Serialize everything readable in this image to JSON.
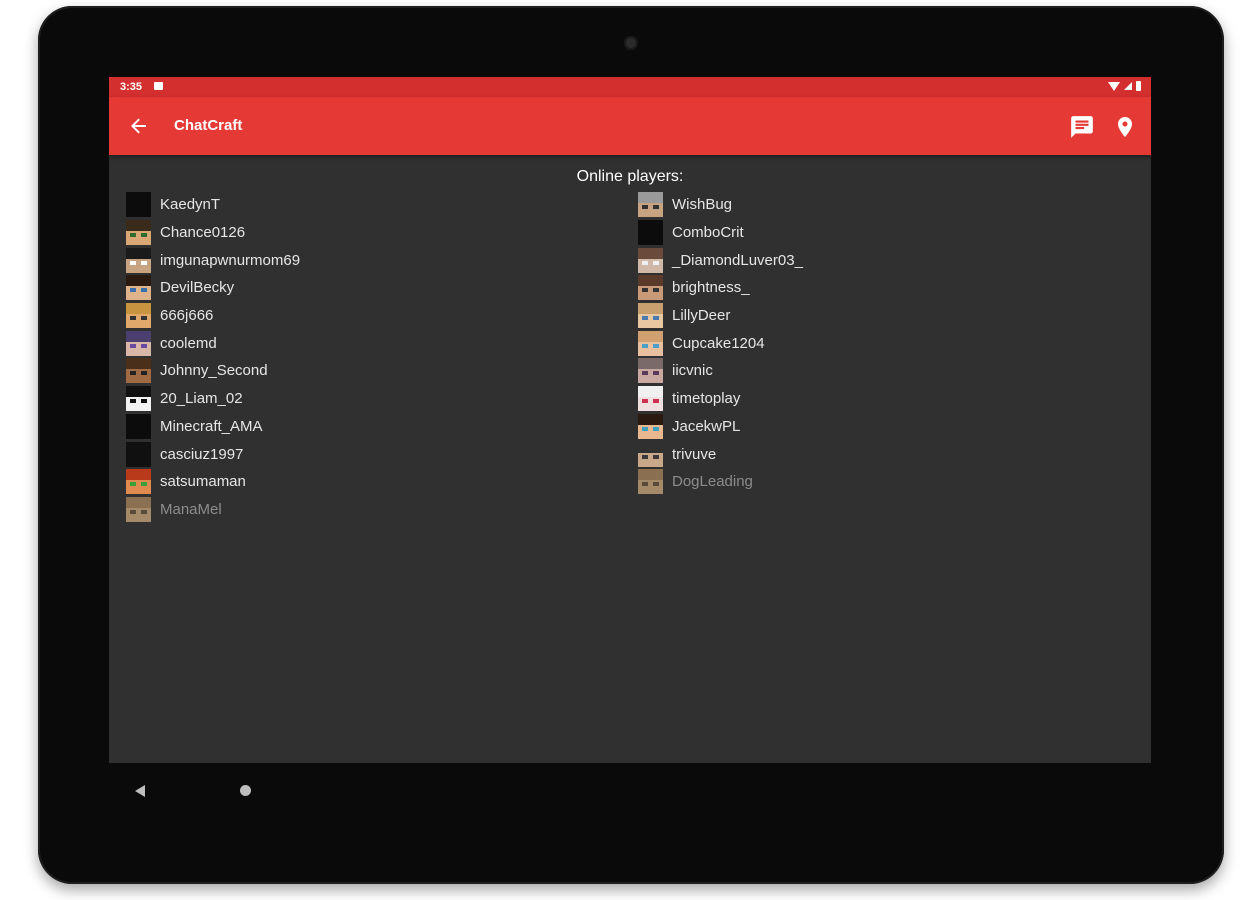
{
  "status_bar": {
    "time": "3:35"
  },
  "app_bar": {
    "title": "ChatCraft"
  },
  "icons": {
    "back": "arrow-back-icon",
    "chat": "chat-bubble-icon",
    "location": "location-pin-icon",
    "nav_back": "nav-back-icon",
    "nav_home": "nav-home-icon"
  },
  "colors": {
    "status_bar": "#d32f2f",
    "app_bar": "#e53935",
    "background": "#303030",
    "text": "#e6e6e6",
    "text_dim": "#8c8c8c"
  },
  "players_heading": "Online players:",
  "players_left": [
    {
      "name": "KaedynT",
      "dim": false,
      "skin": "#0c0c0c",
      "hair": "#0c0c0c",
      "eyes": "#0c0c0c"
    },
    {
      "name": "Chance0126",
      "dim": false,
      "skin": "#d9a774",
      "hair": "#3a2a1a",
      "eyes": "#2f6b2f"
    },
    {
      "name": "imgunapwnurmom69",
      "dim": false,
      "skin": "#c8a382",
      "hair": "#1a1a1a",
      "eyes": "#ffffff"
    },
    {
      "name": "DevilBecky",
      "dim": false,
      "skin": "#e0b48a",
      "hair": "#2a1a10",
      "eyes": "#3a6fb0"
    },
    {
      "name": "666j666",
      "dim": false,
      "skin": "#e0a86a",
      "hair": "#c8943f",
      "eyes": "#333333"
    },
    {
      "name": "coolemd",
      "dim": false,
      "skin": "#d8b6a8",
      "hair": "#4a3f6e",
      "eyes": "#6a4aa0"
    },
    {
      "name": "Johnny_Second",
      "dim": false,
      "skin": "#a06a45",
      "hair": "#4a2f1a",
      "eyes": "#222222"
    },
    {
      "name": "20_Liam_02",
      "dim": false,
      "skin": "#f2f2f2",
      "hair": "#111111",
      "eyes": "#111111"
    },
    {
      "name": "Minecraft_AMA",
      "dim": false,
      "skin": "#0c0c0c",
      "hair": "#0c0c0c",
      "eyes": "#0c0c0c"
    },
    {
      "name": "casciuz1997",
      "dim": false,
      "skin": "#101010",
      "hair": "#101010",
      "eyes": "#101010"
    },
    {
      "name": "satsumaman",
      "dim": false,
      "skin": "#e08a50",
      "hair": "#b83a1a",
      "eyes": "#3aa03a"
    },
    {
      "name": "ManaMel",
      "dim": true,
      "skin": "#a58a6a",
      "hair": "#8a7050",
      "eyes": "#5a4a3a"
    }
  ],
  "players_right": [
    {
      "name": "WishBug",
      "dim": false,
      "skin": "#c8a382",
      "hair": "#9a9a9a",
      "eyes": "#333333"
    },
    {
      "name": "ComboCrit",
      "dim": false,
      "skin": "#0c0c0c",
      "hair": "#0c0c0c",
      "eyes": "#0c0c0c"
    },
    {
      "name": "_DiamondLuver03_",
      "dim": false,
      "skin": "#d0b8a8",
      "hair": "#6a4a3a",
      "eyes": "#f0f0f0"
    },
    {
      "name": "brightness_",
      "dim": false,
      "skin": "#c89a78",
      "hair": "#5a3a2a",
      "eyes": "#333333"
    },
    {
      "name": "LillyDeer",
      "dim": false,
      "skin": "#e8c8a0",
      "hair": "#c8a070",
      "eyes": "#4a7ab0"
    },
    {
      "name": "Cupcake1204",
      "dim": false,
      "skin": "#e8c0a0",
      "hair": "#d0a070",
      "eyes": "#4aa0c8"
    },
    {
      "name": "iicvnic",
      "dim": false,
      "skin": "#c8a8a0",
      "hair": "#7a6a6a",
      "eyes": "#5a3a5a"
    },
    {
      "name": "timetoplay",
      "dim": false,
      "skin": "#f0e0e0",
      "hair": "#f0f0f0",
      "eyes": "#d03050"
    },
    {
      "name": "JacekwPL",
      "dim": false,
      "skin": "#e8b890",
      "hair": "#2a1a10",
      "eyes": "#40a0c0"
    },
    {
      "name": "trivuve",
      "dim": false,
      "skin": "#c8a888",
      "hair": "#303030",
      "eyes": "#3a3a3a"
    },
    {
      "name": "DogLeading",
      "dim": true,
      "skin": "#a58a6a",
      "hair": "#8a7050",
      "eyes": "#5a4a3a"
    }
  ]
}
